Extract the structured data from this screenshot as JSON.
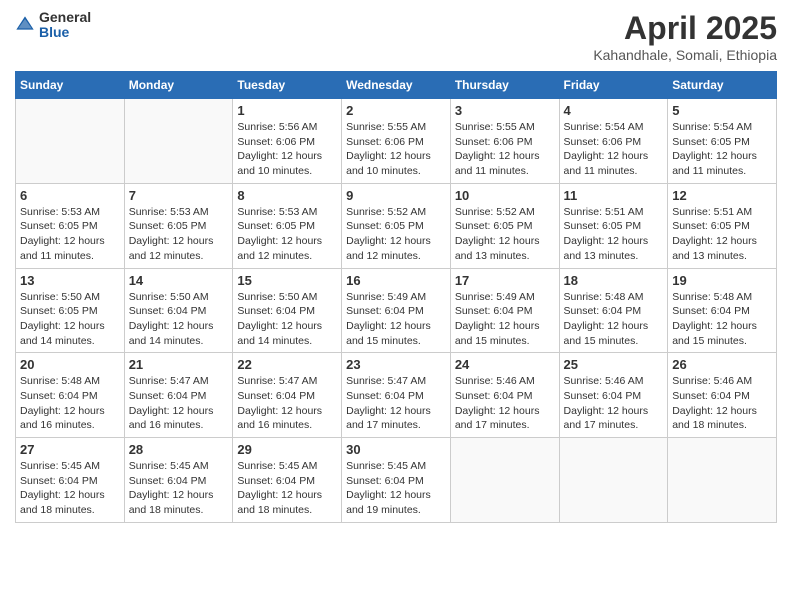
{
  "header": {
    "logo_general": "General",
    "logo_blue": "Blue",
    "month_title": "April 2025",
    "location": "Kahandhale, Somali, Ethiopia"
  },
  "weekdays": [
    "Sunday",
    "Monday",
    "Tuesday",
    "Wednesday",
    "Thursday",
    "Friday",
    "Saturday"
  ],
  "weeks": [
    [
      {
        "day": "",
        "info": ""
      },
      {
        "day": "",
        "info": ""
      },
      {
        "day": "1",
        "info": "Sunrise: 5:56 AM\nSunset: 6:06 PM\nDaylight: 12 hours and 10 minutes."
      },
      {
        "day": "2",
        "info": "Sunrise: 5:55 AM\nSunset: 6:06 PM\nDaylight: 12 hours and 10 minutes."
      },
      {
        "day": "3",
        "info": "Sunrise: 5:55 AM\nSunset: 6:06 PM\nDaylight: 12 hours and 11 minutes."
      },
      {
        "day": "4",
        "info": "Sunrise: 5:54 AM\nSunset: 6:06 PM\nDaylight: 12 hours and 11 minutes."
      },
      {
        "day": "5",
        "info": "Sunrise: 5:54 AM\nSunset: 6:05 PM\nDaylight: 12 hours and 11 minutes."
      }
    ],
    [
      {
        "day": "6",
        "info": "Sunrise: 5:53 AM\nSunset: 6:05 PM\nDaylight: 12 hours and 11 minutes."
      },
      {
        "day": "7",
        "info": "Sunrise: 5:53 AM\nSunset: 6:05 PM\nDaylight: 12 hours and 12 minutes."
      },
      {
        "day": "8",
        "info": "Sunrise: 5:53 AM\nSunset: 6:05 PM\nDaylight: 12 hours and 12 minutes."
      },
      {
        "day": "9",
        "info": "Sunrise: 5:52 AM\nSunset: 6:05 PM\nDaylight: 12 hours and 12 minutes."
      },
      {
        "day": "10",
        "info": "Sunrise: 5:52 AM\nSunset: 6:05 PM\nDaylight: 12 hours and 13 minutes."
      },
      {
        "day": "11",
        "info": "Sunrise: 5:51 AM\nSunset: 6:05 PM\nDaylight: 12 hours and 13 minutes."
      },
      {
        "day": "12",
        "info": "Sunrise: 5:51 AM\nSunset: 6:05 PM\nDaylight: 12 hours and 13 minutes."
      }
    ],
    [
      {
        "day": "13",
        "info": "Sunrise: 5:50 AM\nSunset: 6:05 PM\nDaylight: 12 hours and 14 minutes."
      },
      {
        "day": "14",
        "info": "Sunrise: 5:50 AM\nSunset: 6:04 PM\nDaylight: 12 hours and 14 minutes."
      },
      {
        "day": "15",
        "info": "Sunrise: 5:50 AM\nSunset: 6:04 PM\nDaylight: 12 hours and 14 minutes."
      },
      {
        "day": "16",
        "info": "Sunrise: 5:49 AM\nSunset: 6:04 PM\nDaylight: 12 hours and 15 minutes."
      },
      {
        "day": "17",
        "info": "Sunrise: 5:49 AM\nSunset: 6:04 PM\nDaylight: 12 hours and 15 minutes."
      },
      {
        "day": "18",
        "info": "Sunrise: 5:48 AM\nSunset: 6:04 PM\nDaylight: 12 hours and 15 minutes."
      },
      {
        "day": "19",
        "info": "Sunrise: 5:48 AM\nSunset: 6:04 PM\nDaylight: 12 hours and 15 minutes."
      }
    ],
    [
      {
        "day": "20",
        "info": "Sunrise: 5:48 AM\nSunset: 6:04 PM\nDaylight: 12 hours and 16 minutes."
      },
      {
        "day": "21",
        "info": "Sunrise: 5:47 AM\nSunset: 6:04 PM\nDaylight: 12 hours and 16 minutes."
      },
      {
        "day": "22",
        "info": "Sunrise: 5:47 AM\nSunset: 6:04 PM\nDaylight: 12 hours and 16 minutes."
      },
      {
        "day": "23",
        "info": "Sunrise: 5:47 AM\nSunset: 6:04 PM\nDaylight: 12 hours and 17 minutes."
      },
      {
        "day": "24",
        "info": "Sunrise: 5:46 AM\nSunset: 6:04 PM\nDaylight: 12 hours and 17 minutes."
      },
      {
        "day": "25",
        "info": "Sunrise: 5:46 AM\nSunset: 6:04 PM\nDaylight: 12 hours and 17 minutes."
      },
      {
        "day": "26",
        "info": "Sunrise: 5:46 AM\nSunset: 6:04 PM\nDaylight: 12 hours and 18 minutes."
      }
    ],
    [
      {
        "day": "27",
        "info": "Sunrise: 5:45 AM\nSunset: 6:04 PM\nDaylight: 12 hours and 18 minutes."
      },
      {
        "day": "28",
        "info": "Sunrise: 5:45 AM\nSunset: 6:04 PM\nDaylight: 12 hours and 18 minutes."
      },
      {
        "day": "29",
        "info": "Sunrise: 5:45 AM\nSunset: 6:04 PM\nDaylight: 12 hours and 18 minutes."
      },
      {
        "day": "30",
        "info": "Sunrise: 5:45 AM\nSunset: 6:04 PM\nDaylight: 12 hours and 19 minutes."
      },
      {
        "day": "",
        "info": ""
      },
      {
        "day": "",
        "info": ""
      },
      {
        "day": "",
        "info": ""
      }
    ]
  ]
}
